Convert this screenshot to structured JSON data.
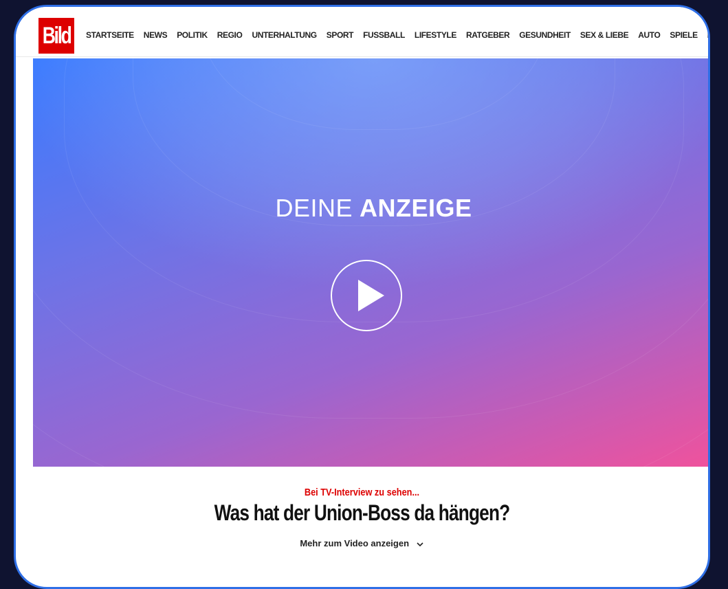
{
  "logo": {
    "text": "Bild",
    "color": "#dd0000"
  },
  "nav": {
    "items": [
      "STARTSEITE",
      "NEWS",
      "POLITIK",
      "REGIO",
      "UNTERHALTUNG",
      "SPORT",
      "FUSSBALL",
      "LIFESTYLE",
      "RATGEBER",
      "GESUNDHEIT",
      "SEX & LIEBE",
      "AUTO",
      "SPIELE",
      "DEALS"
    ]
  },
  "ad": {
    "title_light": "DEINE",
    "title_bold": "ANZEIGE",
    "play_icon": "play-icon",
    "gradient_start": "#3a7bff",
    "gradient_end": "#f0529c"
  },
  "article": {
    "kicker": "Bei TV-Interview zu sehen...",
    "headline": "Was hat der Union-Boss da hängen?",
    "more_label": "Mehr zum Video anzeigen",
    "more_icon": "chevron-down-icon"
  }
}
